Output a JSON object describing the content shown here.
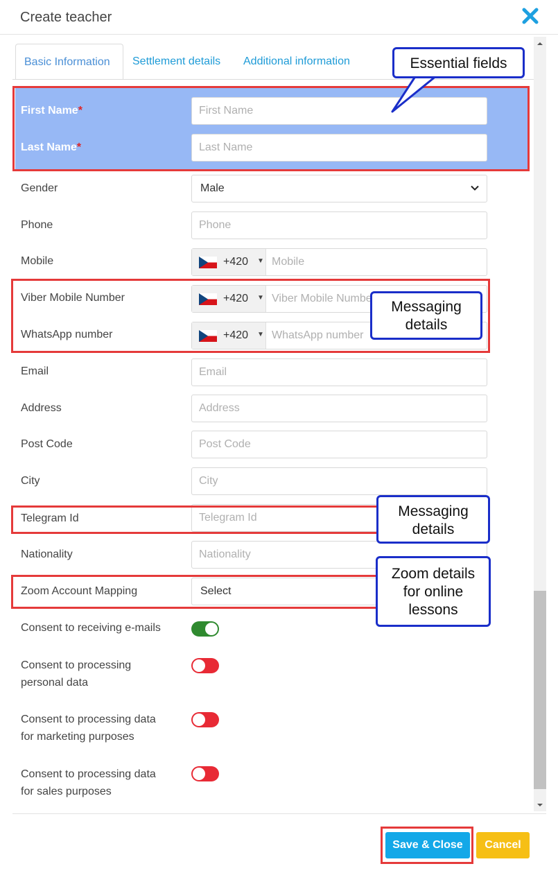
{
  "dialog": {
    "title": "Create teacher"
  },
  "tabs": [
    "Basic Information",
    "Settlement details",
    "Additional information"
  ],
  "fields": {
    "first_name": {
      "label": "First Name",
      "placeholder": "First Name",
      "required_mark": "*"
    },
    "last_name": {
      "label": "Last Name",
      "placeholder": "Last Name",
      "required_mark": "*"
    },
    "gender": {
      "label": "Gender",
      "value": "Male"
    },
    "phone": {
      "label": "Phone",
      "placeholder": "Phone"
    },
    "mobile": {
      "label": "Mobile",
      "code": "+420",
      "placeholder": "Mobile"
    },
    "viber": {
      "label": "Viber Mobile Number",
      "code": "+420",
      "placeholder": "Viber Mobile Number"
    },
    "whatsapp": {
      "label": "WhatsApp number",
      "code": "+420",
      "placeholder": "WhatsApp number"
    },
    "email": {
      "label": "Email",
      "placeholder": "Email"
    },
    "address": {
      "label": "Address",
      "placeholder": "Address"
    },
    "post_code": {
      "label": "Post Code",
      "placeholder": "Post Code"
    },
    "city": {
      "label": "City",
      "placeholder": "City"
    },
    "telegram": {
      "label": "Telegram Id",
      "placeholder": "Telegram Id"
    },
    "nationality": {
      "label": "Nationality",
      "placeholder": "Nationality"
    },
    "zoom": {
      "label": "Zoom Account Mapping",
      "value": "Select"
    }
  },
  "consents": [
    {
      "label": "Consent to receiving e-mails",
      "state": "on"
    },
    {
      "label": "Consent to processing\npersonal data",
      "state": "off"
    },
    {
      "label": "Consent to processing data\nfor marketing purposes",
      "state": "off"
    },
    {
      "label": "Consent to processing data\nfor sales purposes",
      "state": "off"
    }
  ],
  "buttons": {
    "save": "Save & Close",
    "cancel": "Cancel"
  },
  "annotations": {
    "essential": "Essential fields",
    "messaging_1": "Messaging\ndetails",
    "messaging_2": "Messaging\ndetails",
    "zoom": "Zoom details\nfor online\nlessons"
  },
  "colors": {
    "tab_text": "#1e9bd7",
    "essential_bg": "#97b8f5",
    "toggle_on": "#2f8a2f",
    "toggle_off": "#e82a35",
    "save_button": "#13a8e8",
    "cancel_button": "#f6bf15",
    "annotation_box": "#e53a3a",
    "callout_border": "#1a2ec9",
    "close_icon": "#1ea0e0"
  }
}
